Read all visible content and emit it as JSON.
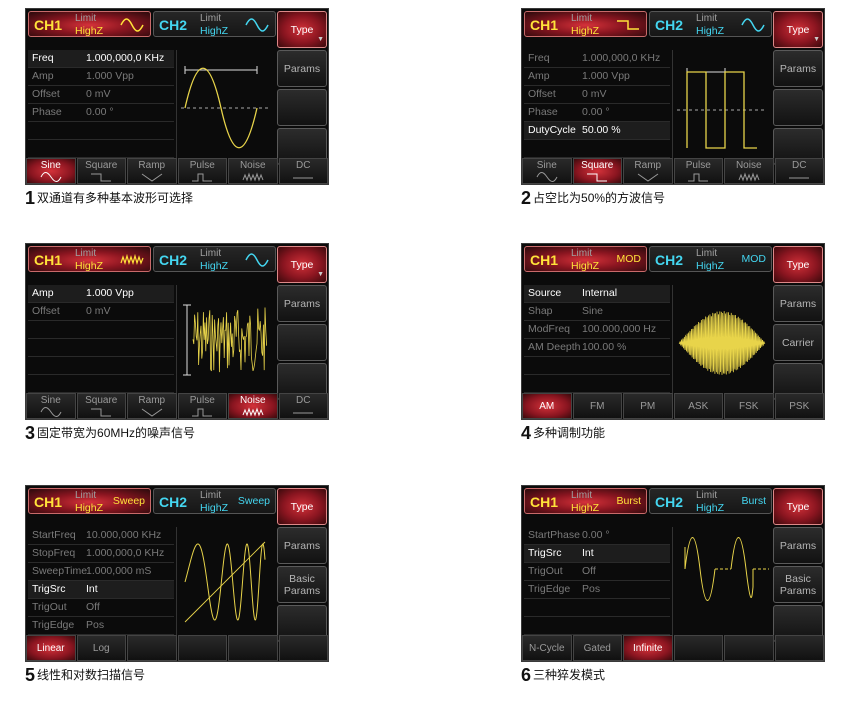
{
  "panels": [
    {
      "ch1": {
        "name": "CH1",
        "limit": "Limit",
        "imp": "HighZ",
        "mode": ""
      },
      "ch2": {
        "name": "CH2",
        "limit": "Limit",
        "imp": "HighZ",
        "mode": ""
      },
      "softkeys": [
        "Type",
        "Params",
        "",
        ""
      ],
      "params": [
        {
          "label": "Freq",
          "value": "1.000,000,0 KHz",
          "sel": true
        },
        {
          "label": "Amp",
          "value": "1.000 Vpp"
        },
        {
          "label": "Offset",
          "value": "0 mV"
        },
        {
          "label": "Phase",
          "value": "0.00 °"
        },
        {
          "label": "",
          "value": ""
        },
        {
          "label": "",
          "value": ""
        }
      ],
      "bottom": [
        "Sine",
        "Square",
        "Ramp",
        "Pulse",
        "Noise",
        "DC"
      ],
      "caption_num": "1",
      "caption_text": "双通道有多种基本波形可选择"
    },
    {
      "ch1": {
        "name": "CH1",
        "limit": "Limit",
        "imp": "HighZ",
        "mode": ""
      },
      "ch2": {
        "name": "CH2",
        "limit": "Limit",
        "imp": "HighZ",
        "mode": ""
      },
      "softkeys": [
        "Type",
        "Params",
        "",
        ""
      ],
      "params": [
        {
          "label": "Freq",
          "value": "1.000,000,0 KHz"
        },
        {
          "label": "Amp",
          "value": "1.000 Vpp"
        },
        {
          "label": "Offset",
          "value": "0 mV"
        },
        {
          "label": "Phase",
          "value": "0.00 °"
        },
        {
          "label": "DutyCycle",
          "value": "50.00 %",
          "sel": true
        },
        {
          "label": "",
          "value": ""
        }
      ],
      "bottom": [
        "Sine",
        "Square",
        "Ramp",
        "Pulse",
        "Noise",
        "DC"
      ],
      "caption_num": "2",
      "caption_text": "占空比为50%的方波信号"
    },
    {
      "ch1": {
        "name": "CH1",
        "limit": "Limit",
        "imp": "HighZ",
        "mode": ""
      },
      "ch2": {
        "name": "CH2",
        "limit": "Limit",
        "imp": "HighZ",
        "mode": ""
      },
      "softkeys": [
        "Type",
        "Params",
        "",
        ""
      ],
      "params": [
        {
          "label": "Amp",
          "value": "1.000 Vpp",
          "sel": true
        },
        {
          "label": "Offset",
          "value": "0 mV"
        },
        {
          "label": "",
          "value": ""
        },
        {
          "label": "",
          "value": ""
        },
        {
          "label": "",
          "value": ""
        },
        {
          "label": "",
          "value": ""
        }
      ],
      "bottom": [
        "Sine",
        "Square",
        "Ramp",
        "Pulse",
        "Noise",
        "DC"
      ],
      "caption_num": "3",
      "caption_text": "固定带宽为60MHz的噪声信号"
    },
    {
      "ch1": {
        "name": "CH1",
        "limit": "Limit",
        "imp": "HighZ",
        "mode": "MOD"
      },
      "ch2": {
        "name": "CH2",
        "limit": "Limit",
        "imp": "HighZ",
        "mode": "MOD"
      },
      "softkeys": [
        "Type",
        "Params",
        "Carrier",
        ""
      ],
      "params": [
        {
          "label": "Source",
          "value": "Internal",
          "sel": true
        },
        {
          "label": "Shap",
          "value": "Sine"
        },
        {
          "label": "ModFreq",
          "value": "100.000,000 Hz"
        },
        {
          "label": "AM Deepth",
          "value": "100.00 %"
        },
        {
          "label": "",
          "value": ""
        },
        {
          "label": "",
          "value": ""
        }
      ],
      "bottom": [
        "AM",
        "FM",
        "PM",
        "ASK",
        "FSK",
        "PSK"
      ],
      "caption_num": "4",
      "caption_text": "多种调制功能"
    },
    {
      "ch1": {
        "name": "CH1",
        "limit": "Limit",
        "imp": "HighZ",
        "mode": "Sweep"
      },
      "ch2": {
        "name": "CH2",
        "limit": "Limit",
        "imp": "HighZ",
        "mode": "Sweep"
      },
      "softkeys": [
        "Type",
        "Params",
        "Basic\nParams",
        ""
      ],
      "params": [
        {
          "label": "StartFreq",
          "value": "10.000,000 KHz"
        },
        {
          "label": "StopFreq",
          "value": "1.000,000,0 KHz"
        },
        {
          "label": "SweepTime",
          "value": "1.000,000 mS"
        },
        {
          "label": "TrigSrc",
          "value": "Int",
          "sel": true
        },
        {
          "label": "TrigOut",
          "value": "Off"
        },
        {
          "label": "TrigEdge",
          "value": "Pos"
        }
      ],
      "bottom": [
        "Linear",
        "Log",
        "",
        "",
        "",
        ""
      ],
      "caption_num": "5",
      "caption_text": "线性和对数扫描信号"
    },
    {
      "ch1": {
        "name": "CH1",
        "limit": "Limit",
        "imp": "HighZ",
        "mode": "Burst"
      },
      "ch2": {
        "name": "CH2",
        "limit": "Limit",
        "imp": "HighZ",
        "mode": "Burst"
      },
      "softkeys": [
        "Type",
        "Params",
        "Basic\nParams",
        ""
      ],
      "params": [
        {
          "label": "StartPhase",
          "value": "0.00 °"
        },
        {
          "label": "TrigSrc",
          "value": "Int",
          "sel": true
        },
        {
          "label": "TrigOut",
          "value": "Off"
        },
        {
          "label": "TrigEdge",
          "value": "Pos"
        },
        {
          "label": "",
          "value": ""
        },
        {
          "label": "",
          "value": ""
        }
      ],
      "bottom": [
        "N-Cycle",
        "Gated",
        "Infinite",
        "",
        "",
        ""
      ],
      "caption_num": "6",
      "caption_text": "三种猝发模式"
    }
  ],
  "colors": {
    "ch1": "#ffe33a",
    "ch2": "#44d6f0",
    "active": "#c8202c",
    "wave": "#e8d44a"
  }
}
